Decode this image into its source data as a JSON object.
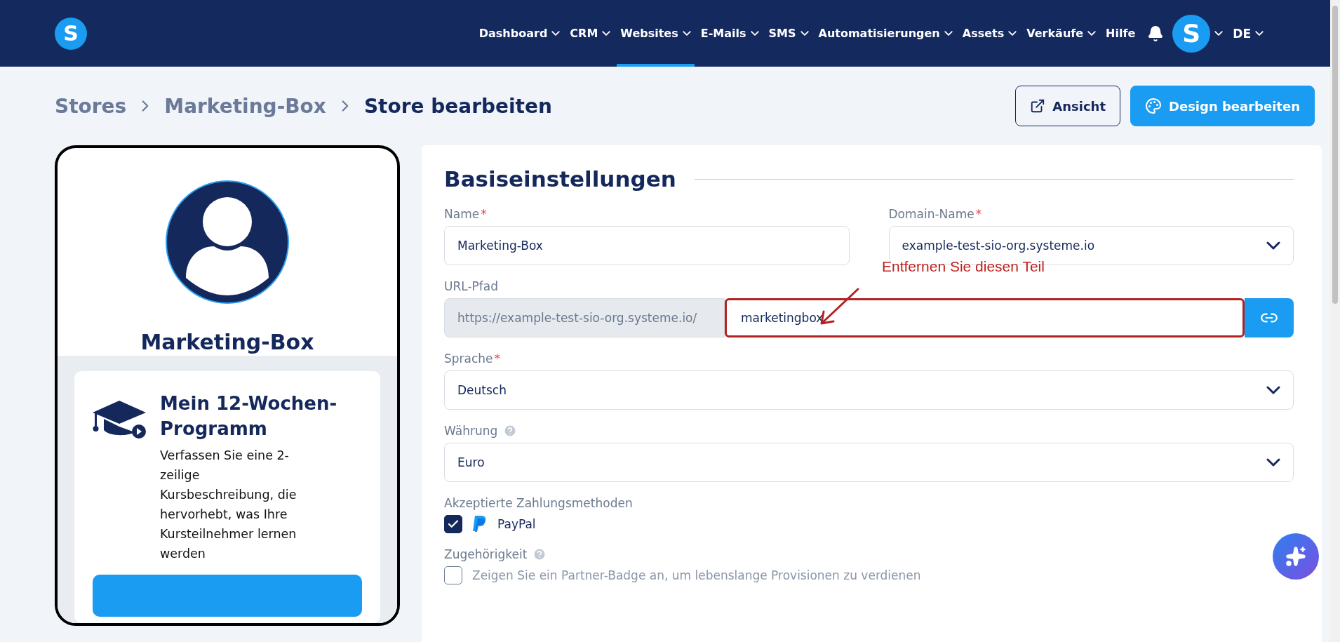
{
  "nav": {
    "items": [
      {
        "label": "Dashboard",
        "dropdown": true,
        "selected": false
      },
      {
        "label": "CRM",
        "dropdown": true,
        "selected": false
      },
      {
        "label": "Websites",
        "dropdown": true,
        "selected": true
      },
      {
        "label": "E-Mails",
        "dropdown": true,
        "selected": false
      },
      {
        "label": "SMS",
        "dropdown": true,
        "selected": false
      },
      {
        "label": "Automatisierungen",
        "dropdown": true,
        "selected": false
      },
      {
        "label": "Assets",
        "dropdown": true,
        "selected": false
      },
      {
        "label": "Verkäufe",
        "dropdown": true,
        "selected": false
      },
      {
        "label": "Hilfe",
        "dropdown": false,
        "selected": false
      }
    ],
    "logo_letter": "S",
    "avatar_letter": "S",
    "language": "DE"
  },
  "breadcrumb": [
    "Stores",
    "Marketing-Box",
    "Store bearbeiten"
  ],
  "actions": [
    {
      "label": "Ansicht",
      "kind": "outline"
    },
    {
      "label": "Design bearbeiten",
      "kind": "primary"
    }
  ],
  "preview": {
    "store_name": "Marketing-Box",
    "course": {
      "title": "Mein 12-Wochen-Programm",
      "description": "Verfassen Sie eine 2-zeilige Kursbeschreibung, die hervorhebt, was Ihre Kursteilnehmer lernen werden"
    }
  },
  "form": {
    "title": "Basiseinstellungen",
    "name": {
      "label": "Name",
      "required_mark": "*",
      "value": "Marketing-Box"
    },
    "domain": {
      "label": "Domain-Name",
      "required_mark": "*",
      "value": "example-test-sio-org.systeme.io"
    },
    "url_path": {
      "label": "URL-Pfad",
      "prefix": "https://example-test-sio-org.systeme.io/",
      "value": "marketingbox"
    },
    "language": {
      "label": "Sprache",
      "required_mark": "*",
      "value": "Deutsch"
    },
    "currency": {
      "label": "Währung",
      "help": true,
      "value": "Euro"
    },
    "payment": {
      "label": "Akzeptierte Zahlungsmethoden",
      "methods": [
        {
          "label": "PayPal",
          "checked": true
        }
      ]
    },
    "affiliation": {
      "label": "Zugehörigkeit",
      "help": true,
      "option": {
        "label": "Zeigen Sie ein Partner-Badge an, um lebenslange Provisionen zu verdienen",
        "checked": false
      }
    }
  },
  "annotation": {
    "text": "Entfernen Sie diesen Teil"
  }
}
